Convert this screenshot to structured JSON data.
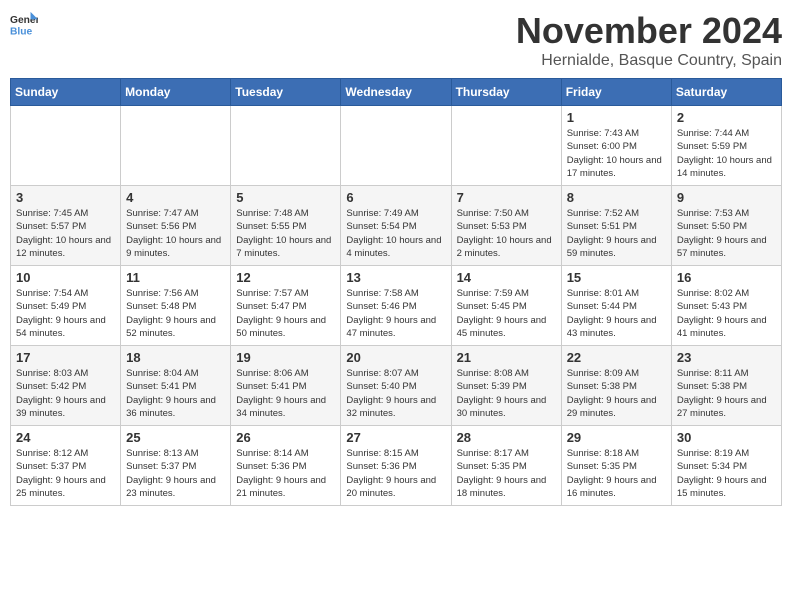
{
  "header": {
    "logo_line1": "General",
    "logo_line2": "Blue",
    "title": "November 2024",
    "subtitle": "Hernialde, Basque Country, Spain"
  },
  "weekdays": [
    "Sunday",
    "Monday",
    "Tuesday",
    "Wednesday",
    "Thursday",
    "Friday",
    "Saturday"
  ],
  "weeks": [
    [
      {
        "day": "",
        "info": ""
      },
      {
        "day": "",
        "info": ""
      },
      {
        "day": "",
        "info": ""
      },
      {
        "day": "",
        "info": ""
      },
      {
        "day": "",
        "info": ""
      },
      {
        "day": "1",
        "info": "Sunrise: 7:43 AM\nSunset: 6:00 PM\nDaylight: 10 hours and 17 minutes."
      },
      {
        "day": "2",
        "info": "Sunrise: 7:44 AM\nSunset: 5:59 PM\nDaylight: 10 hours and 14 minutes."
      }
    ],
    [
      {
        "day": "3",
        "info": "Sunrise: 7:45 AM\nSunset: 5:57 PM\nDaylight: 10 hours and 12 minutes."
      },
      {
        "day": "4",
        "info": "Sunrise: 7:47 AM\nSunset: 5:56 PM\nDaylight: 10 hours and 9 minutes."
      },
      {
        "day": "5",
        "info": "Sunrise: 7:48 AM\nSunset: 5:55 PM\nDaylight: 10 hours and 7 minutes."
      },
      {
        "day": "6",
        "info": "Sunrise: 7:49 AM\nSunset: 5:54 PM\nDaylight: 10 hours and 4 minutes."
      },
      {
        "day": "7",
        "info": "Sunrise: 7:50 AM\nSunset: 5:53 PM\nDaylight: 10 hours and 2 minutes."
      },
      {
        "day": "8",
        "info": "Sunrise: 7:52 AM\nSunset: 5:51 PM\nDaylight: 9 hours and 59 minutes."
      },
      {
        "day": "9",
        "info": "Sunrise: 7:53 AM\nSunset: 5:50 PM\nDaylight: 9 hours and 57 minutes."
      }
    ],
    [
      {
        "day": "10",
        "info": "Sunrise: 7:54 AM\nSunset: 5:49 PM\nDaylight: 9 hours and 54 minutes."
      },
      {
        "day": "11",
        "info": "Sunrise: 7:56 AM\nSunset: 5:48 PM\nDaylight: 9 hours and 52 minutes."
      },
      {
        "day": "12",
        "info": "Sunrise: 7:57 AM\nSunset: 5:47 PM\nDaylight: 9 hours and 50 minutes."
      },
      {
        "day": "13",
        "info": "Sunrise: 7:58 AM\nSunset: 5:46 PM\nDaylight: 9 hours and 47 minutes."
      },
      {
        "day": "14",
        "info": "Sunrise: 7:59 AM\nSunset: 5:45 PM\nDaylight: 9 hours and 45 minutes."
      },
      {
        "day": "15",
        "info": "Sunrise: 8:01 AM\nSunset: 5:44 PM\nDaylight: 9 hours and 43 minutes."
      },
      {
        "day": "16",
        "info": "Sunrise: 8:02 AM\nSunset: 5:43 PM\nDaylight: 9 hours and 41 minutes."
      }
    ],
    [
      {
        "day": "17",
        "info": "Sunrise: 8:03 AM\nSunset: 5:42 PM\nDaylight: 9 hours and 39 minutes."
      },
      {
        "day": "18",
        "info": "Sunrise: 8:04 AM\nSunset: 5:41 PM\nDaylight: 9 hours and 36 minutes."
      },
      {
        "day": "19",
        "info": "Sunrise: 8:06 AM\nSunset: 5:41 PM\nDaylight: 9 hours and 34 minutes."
      },
      {
        "day": "20",
        "info": "Sunrise: 8:07 AM\nSunset: 5:40 PM\nDaylight: 9 hours and 32 minutes."
      },
      {
        "day": "21",
        "info": "Sunrise: 8:08 AM\nSunset: 5:39 PM\nDaylight: 9 hours and 30 minutes."
      },
      {
        "day": "22",
        "info": "Sunrise: 8:09 AM\nSunset: 5:38 PM\nDaylight: 9 hours and 29 minutes."
      },
      {
        "day": "23",
        "info": "Sunrise: 8:11 AM\nSunset: 5:38 PM\nDaylight: 9 hours and 27 minutes."
      }
    ],
    [
      {
        "day": "24",
        "info": "Sunrise: 8:12 AM\nSunset: 5:37 PM\nDaylight: 9 hours and 25 minutes."
      },
      {
        "day": "25",
        "info": "Sunrise: 8:13 AM\nSunset: 5:37 PM\nDaylight: 9 hours and 23 minutes."
      },
      {
        "day": "26",
        "info": "Sunrise: 8:14 AM\nSunset: 5:36 PM\nDaylight: 9 hours and 21 minutes."
      },
      {
        "day": "27",
        "info": "Sunrise: 8:15 AM\nSunset: 5:36 PM\nDaylight: 9 hours and 20 minutes."
      },
      {
        "day": "28",
        "info": "Sunrise: 8:17 AM\nSunset: 5:35 PM\nDaylight: 9 hours and 18 minutes."
      },
      {
        "day": "29",
        "info": "Sunrise: 8:18 AM\nSunset: 5:35 PM\nDaylight: 9 hours and 16 minutes."
      },
      {
        "day": "30",
        "info": "Sunrise: 8:19 AM\nSunset: 5:34 PM\nDaylight: 9 hours and 15 minutes."
      }
    ]
  ]
}
